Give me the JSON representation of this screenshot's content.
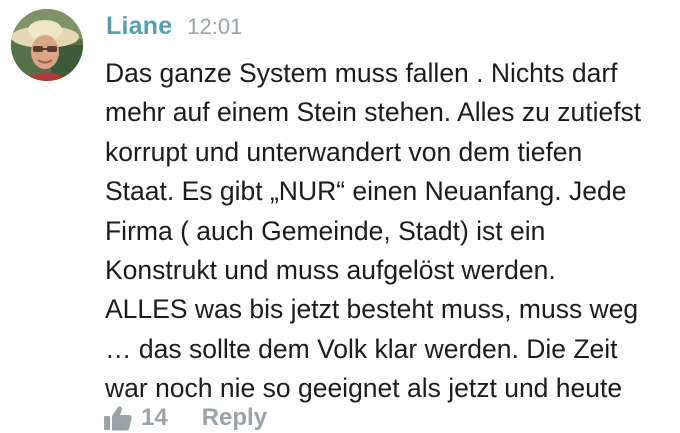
{
  "comment": {
    "author": "Liane",
    "time": "12:01",
    "avatar_icon": "user-avatar-photo",
    "lines": [
      "Das ganze System muss fallen . Nichts darf",
      "mehr auf einem Stein stehen. Alles zu zutiefst",
      "korrupt und unterwandert von dem tiefen",
      "Staat. Es gibt „NUR“ einen Neuanfang. Jede",
      "Firma ( auch Gemeinde, Stadt) ist ein",
      "Konstrukt und muss aufgelöst werden.",
      "ALLES was bis jetzt besteht muss, muss weg",
      "… das sollte dem Volk klar werden. Die Zeit",
      "war noch nie so geeignet als jetzt und heute"
    ],
    "likes": "14",
    "reply_label": "Reply",
    "like_icon": "thumbs-up-icon"
  },
  "colors": {
    "author": "#5a9db0",
    "meta": "#9aa3a8",
    "text": "#1c1c1c"
  }
}
